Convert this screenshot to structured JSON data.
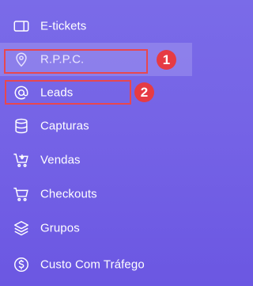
{
  "colors": {
    "sidebar_top": "#7a6be8",
    "sidebar_bottom": "#6b57e2",
    "text": "#ffffff",
    "annotation_red": "#e63b44"
  },
  "menu": {
    "items": [
      {
        "label": "E-tickets",
        "icon": "ticket-icon"
      },
      {
        "label": "R.P.P.C.",
        "icon": "map-pin-icon",
        "active": true
      },
      {
        "label": "Leads",
        "icon": "at-sign-icon"
      },
      {
        "label": "Capturas",
        "icon": "database-icon"
      },
      {
        "label": "Vendas",
        "icon": "cart-download-icon"
      },
      {
        "label": "Checkouts",
        "icon": "shopping-cart-icon"
      },
      {
        "label": "Grupos",
        "icon": "layers-icon"
      },
      {
        "label": "Custo Com Tráfego",
        "icon": "dollar-coin-icon"
      }
    ]
  },
  "annotations": {
    "badge_1": "1",
    "badge_2": "2"
  }
}
